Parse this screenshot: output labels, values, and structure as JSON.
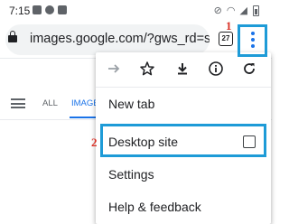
{
  "status_bar": {
    "time": "7:15"
  },
  "address_bar": {
    "url": "images.google.com/?gws_rd=ssl",
    "tab_count": "27"
  },
  "annotations": {
    "step1": "1",
    "step2": "2",
    "highlight_color": "#1e9bd7",
    "number_color": "#d93025"
  },
  "google_page": {
    "tabs": [
      {
        "label": "ALL"
      },
      {
        "label": "IMAGE"
      }
    ]
  },
  "menu": {
    "icons": [
      "forward-icon",
      "star-icon",
      "download-icon",
      "info-icon",
      "refresh-icon"
    ],
    "items": [
      {
        "label": "New tab"
      },
      {
        "label": "Desktop site",
        "checked": false
      },
      {
        "label": "Settings"
      },
      {
        "label": "Help & feedback"
      }
    ]
  },
  "colors": {
    "accent": "#1a73e8",
    "text": "#202124",
    "muted_icon": "#5f6368"
  }
}
